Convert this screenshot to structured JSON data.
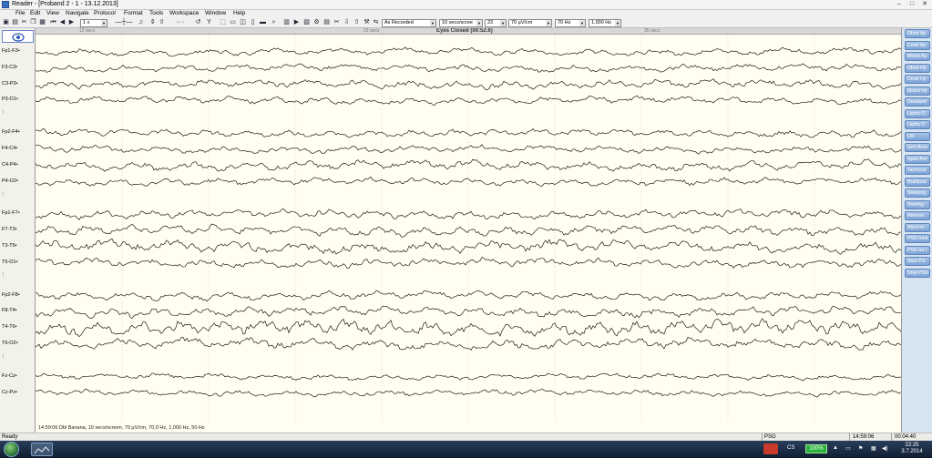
{
  "window": {
    "title": "Reader - [Proband 2 - 1 - 13.12.2013]"
  },
  "menu": [
    "File",
    "Edit",
    "View",
    "Navigate",
    "Protocol",
    "Format",
    "Tools",
    "Workspace",
    "Window",
    "Help"
  ],
  "toolbar": {
    "speed": "1 x",
    "recording": "As Recorded",
    "timebase": "10 secs/scree",
    "channels": "23",
    "sensitivity": "70 µV/cm",
    "lowpass": "70 Hz",
    "highpass": "1,000 Hz"
  },
  "event_bar": {
    "label": "Eyes Closed (00:52.6)",
    "time_marks": [
      "12 secs",
      "22 secs",
      "35 secs"
    ]
  },
  "channels": [
    {
      "label": "Fp1-F3•"
    },
    {
      "label": "F3-C3•"
    },
    {
      "label": "C3-P3•"
    },
    {
      "label": "P3-O1•"
    },
    {
      "label": "Fp2-F4•"
    },
    {
      "label": "F4-C4•"
    },
    {
      "label": "C4-P4•"
    },
    {
      "label": "P4-O2•"
    },
    {
      "label": "Fp1-F7•"
    },
    {
      "label": "F7-T3•"
    },
    {
      "label": "T3-T5•"
    },
    {
      "label": "T5-O1•"
    },
    {
      "label": "Fp2-F8•"
    },
    {
      "label": "F8-T4•"
    },
    {
      "label": "T4-T6•"
    },
    {
      "label": "T6-O2•"
    },
    {
      "label": "Fz-Cz•"
    },
    {
      "label": "Cz-Pz•"
    }
  ],
  "montage_info": "14:59:06 Dbl Banana, 10 secs/screen, 70 µV/cm, 70,0 Hz, 1,000 Hz, 50 Hz",
  "event_buttons": [
    "Obstr Ap",
    "Centr Ap",
    "Mixed Ap",
    "Obstr Hy",
    "Centr Hy",
    "Mixed Hy",
    "Desature",
    "Lights O",
    "Lights O",
    "LM",
    "Gen Arou",
    "Spon Aro",
    "Tachycar",
    "Bradycar",
    "Sleeping",
    "Snoring",
    "Abnorm",
    "Abnorm",
    "PSG Inva",
    "PSG no t",
    "Start PS",
    "Stop PSG"
  ],
  "status": {
    "left": "Ready",
    "mode": "PSG",
    "time": "14:59:06",
    "elapsed": "00:04:40"
  },
  "taskbar": {
    "lang": "CS",
    "zoom": "100%",
    "clock_time": "22:25",
    "clock_date": "3.7.2014"
  },
  "colors": {
    "trace": "#1c1c1c",
    "background": "#fffef0",
    "event_button": "#7ea4d6"
  }
}
